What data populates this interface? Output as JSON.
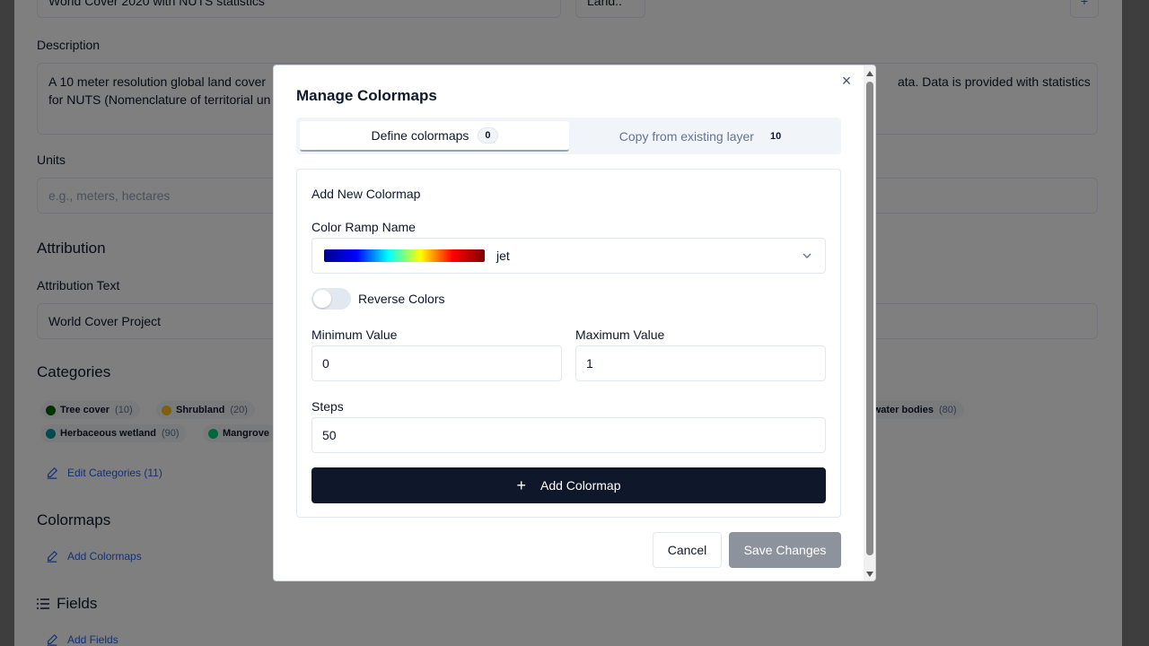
{
  "background": {
    "name_value": "World Cover 2020 with NUTS statistics",
    "type_value": "Land..",
    "description_label": "Description",
    "description_line1_left": "A 10 meter resolution global land cover",
    "description_line1_right": "ata.  Data is provided with statistics",
    "description_line2_left": "for NUTS (Nomenclature of territorial un",
    "units_label": "Units",
    "units_placeholder": "e.g., meters, hectares",
    "attribution_heading": "Attribution",
    "attribution_text_label": "Attribution Text",
    "attribution_value": "World Cover Project",
    "categories_heading": "Categories",
    "categories": [
      {
        "name": "Tree cover",
        "code": "(10)",
        "color": "#006400"
      },
      {
        "name": "Shrubland",
        "code": "(20)",
        "color": "#ffbb22"
      },
      {
        "name": "Herbaceous wetland",
        "code": "(90)",
        "color": "#0096a0"
      },
      {
        "name": "Mangrove",
        "code": "",
        "color": "#00cf75"
      },
      {
        "name": "t water bodies",
        "code": "(80)",
        "color": ""
      }
    ],
    "edit_categories": "Edit Categories (11)",
    "colormaps_heading": "Colormaps",
    "add_colormaps": "Add Colormaps",
    "fields_heading": "Fields",
    "add_fields": "Add Fields",
    "plus_button": "+"
  },
  "modal": {
    "title": "Manage Colormaps",
    "close_glyph": "×",
    "tabs": [
      {
        "label": "Define colormaps",
        "count": "0"
      },
      {
        "label": "Copy from existing layer",
        "count": "10"
      }
    ],
    "card_title": "Add New Colormap",
    "ramp_label": "Color Ramp Name",
    "ramp_value": "jet",
    "ramp_colors": [
      "#00008f",
      "#0000ff",
      "#00ffff",
      "#ffff00",
      "#ff0000",
      "#800000"
    ],
    "reverse_label": "Reverse Colors",
    "reverse_on": false,
    "min_label": "Minimum Value",
    "min_value": "0",
    "max_label": "Maximum Value",
    "max_value": "1",
    "steps_label": "Steps",
    "steps_value": "50",
    "add_button": "Add Colormap",
    "add_icon": "+",
    "cancel": "Cancel",
    "save": "Save Changes"
  }
}
